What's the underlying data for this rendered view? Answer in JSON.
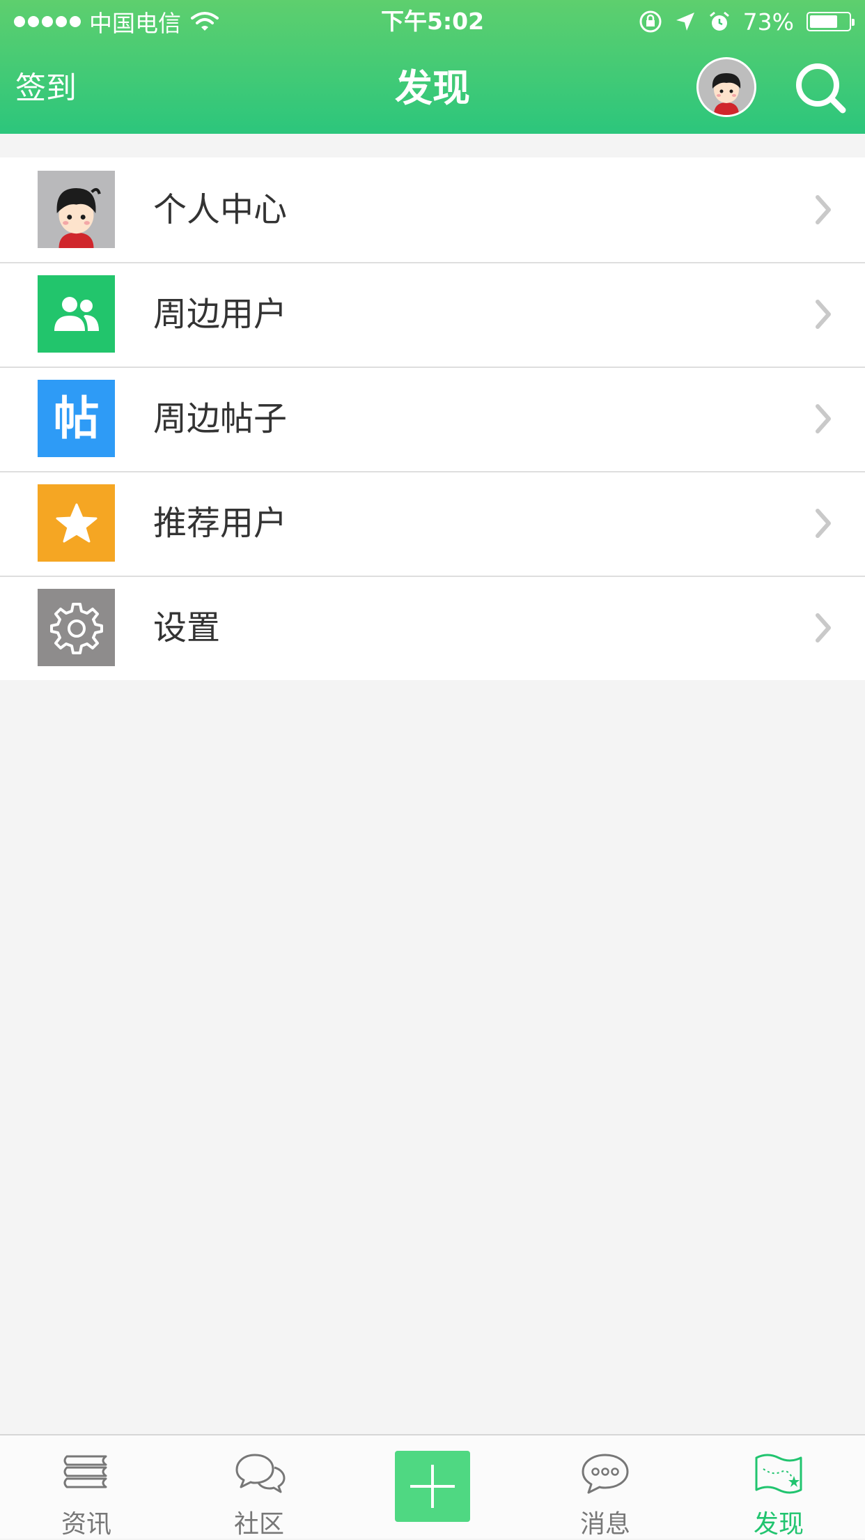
{
  "status_bar": {
    "carrier": "中国电信",
    "time": "下午5:02",
    "battery_percent": "73%",
    "battery_level": 0.73
  },
  "nav": {
    "left_label": "签到",
    "title": "发现"
  },
  "menu": {
    "items": [
      {
        "label": "个人中心",
        "icon": "user-avatar-icon",
        "color": "#b8b8b8"
      },
      {
        "label": "周边用户",
        "icon": "people-icon",
        "color": "#22c56c"
      },
      {
        "label": "周边帖子",
        "icon": "post-icon",
        "icon_text": "帖",
        "color": "#2e9bf6"
      },
      {
        "label": "推荐用户",
        "icon": "star-icon",
        "color": "#f5a623"
      },
      {
        "label": "设置",
        "icon": "gear-icon",
        "color": "#8e8c8c"
      }
    ]
  },
  "tabs": {
    "items": [
      {
        "label": "资讯",
        "icon": "books-icon"
      },
      {
        "label": "社区",
        "icon": "chat-bubbles-icon"
      },
      {
        "label": "",
        "icon": "plus-icon"
      },
      {
        "label": "消息",
        "icon": "message-icon"
      },
      {
        "label": "发现",
        "icon": "map-flag-icon",
        "active": true
      }
    ]
  },
  "colors": {
    "header_top": "#5ecf6e",
    "header_bottom": "#2cc67c",
    "active_tab": "#21c46f",
    "plus_button": "#4fd882"
  }
}
